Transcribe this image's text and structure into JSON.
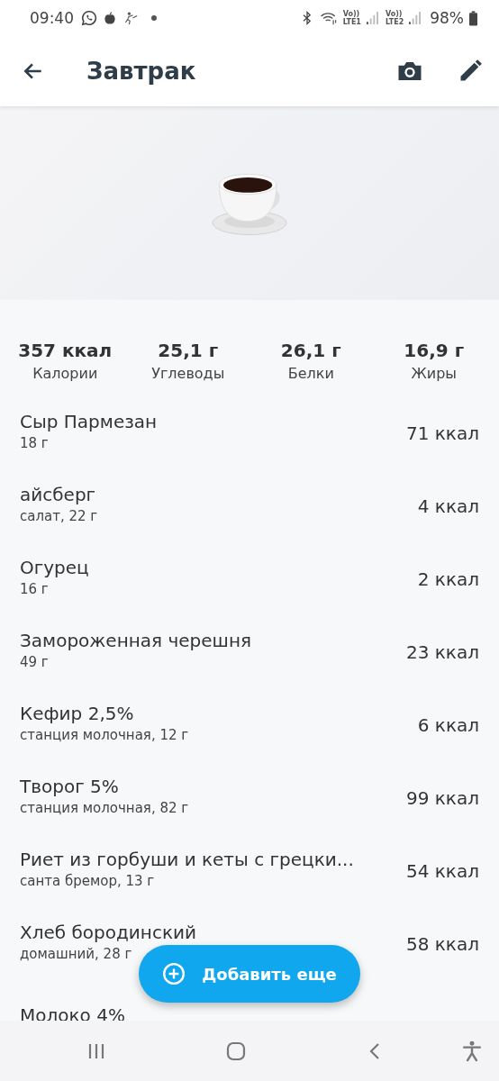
{
  "status_bar": {
    "time": "09:40",
    "sims": [
      {
        "top": "Vo))",
        "bottom": "LTE1"
      },
      {
        "top": "Vo))",
        "bottom": "LTE2"
      }
    ],
    "battery": "98%"
  },
  "header": {
    "title": "Завтрак"
  },
  "summary": [
    {
      "value": "357 ккал",
      "label": "Калории"
    },
    {
      "value": "25,1 г",
      "label": "Углеводы"
    },
    {
      "value": "26,1 г",
      "label": "Белки"
    },
    {
      "value": "16,9 г",
      "label": "Жиры"
    }
  ],
  "items": [
    {
      "name": "Сыр Пармезан",
      "detail": "18 г",
      "kcal": "71 ккал"
    },
    {
      "name": "айсберг",
      "detail": "салат, 22 г",
      "kcal": "4 ккал"
    },
    {
      "name": "Огурец",
      "detail": "16 г",
      "kcal": "2 ккал"
    },
    {
      "name": "Замороженная черешня",
      "detail": "49 г",
      "kcal": "23 ккал"
    },
    {
      "name": "Кефир 2,5%",
      "detail": "станция молочная, 12 г",
      "kcal": "6 ккал"
    },
    {
      "name": "Творог 5%",
      "detail": "станция молочная, 82 г",
      "kcal": "99 ккал"
    },
    {
      "name": "Риет из горбуши и кеты с грецки...",
      "detail": "санта бремор, 13 г",
      "kcal": "54 ккал"
    },
    {
      "name": "Хлеб бородинский",
      "detail": "домашний, 28 г",
      "kcal": "58 ккал"
    },
    {
      "name": "Молоко 4%"
    }
  ],
  "add_button": {
    "label": "Добавить еще"
  }
}
